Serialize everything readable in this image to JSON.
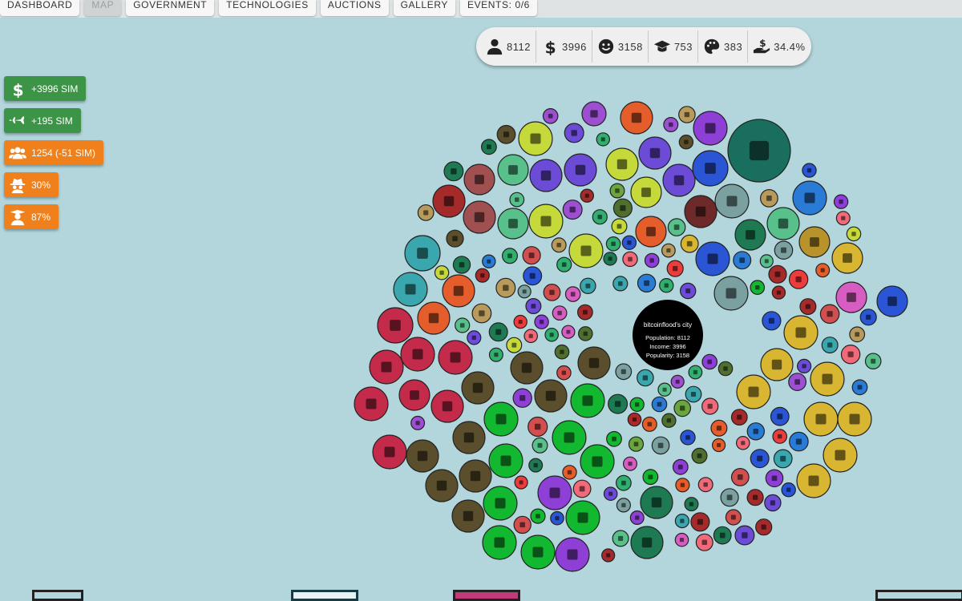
{
  "nav": {
    "tabs": [
      {
        "label": "DASHBOARD",
        "active": false
      },
      {
        "label": "MAP",
        "active": true
      },
      {
        "label": "GOVERNMENT",
        "active": false
      },
      {
        "label": "TECHNOLOGIES",
        "active": false
      },
      {
        "label": "AUCTIONS",
        "active": false
      },
      {
        "label": "GALLERY",
        "active": false
      },
      {
        "label": "EVENTS: 0/6",
        "active": false
      }
    ]
  },
  "stats": {
    "population": "8112",
    "money": "3996",
    "happiness": "3158",
    "education": "753",
    "culture": "383",
    "tax_rate": "34.4%"
  },
  "badges": {
    "income": "+3996 SIM",
    "tourism": "+195 SIM",
    "citizens": "1254 (-51 SIM)",
    "crime": "30%",
    "education": "87%"
  },
  "city": {
    "name": "bitcoinflood's city",
    "population_label": "Population: 8112",
    "income_label": "Income: 3996",
    "popularity_label": "Popularity: 3158"
  },
  "colors": {
    "background": "#b3d6dc",
    "green_badge": "#3c9447",
    "orange_badge": "#f0801b",
    "center": "#000000"
  }
}
